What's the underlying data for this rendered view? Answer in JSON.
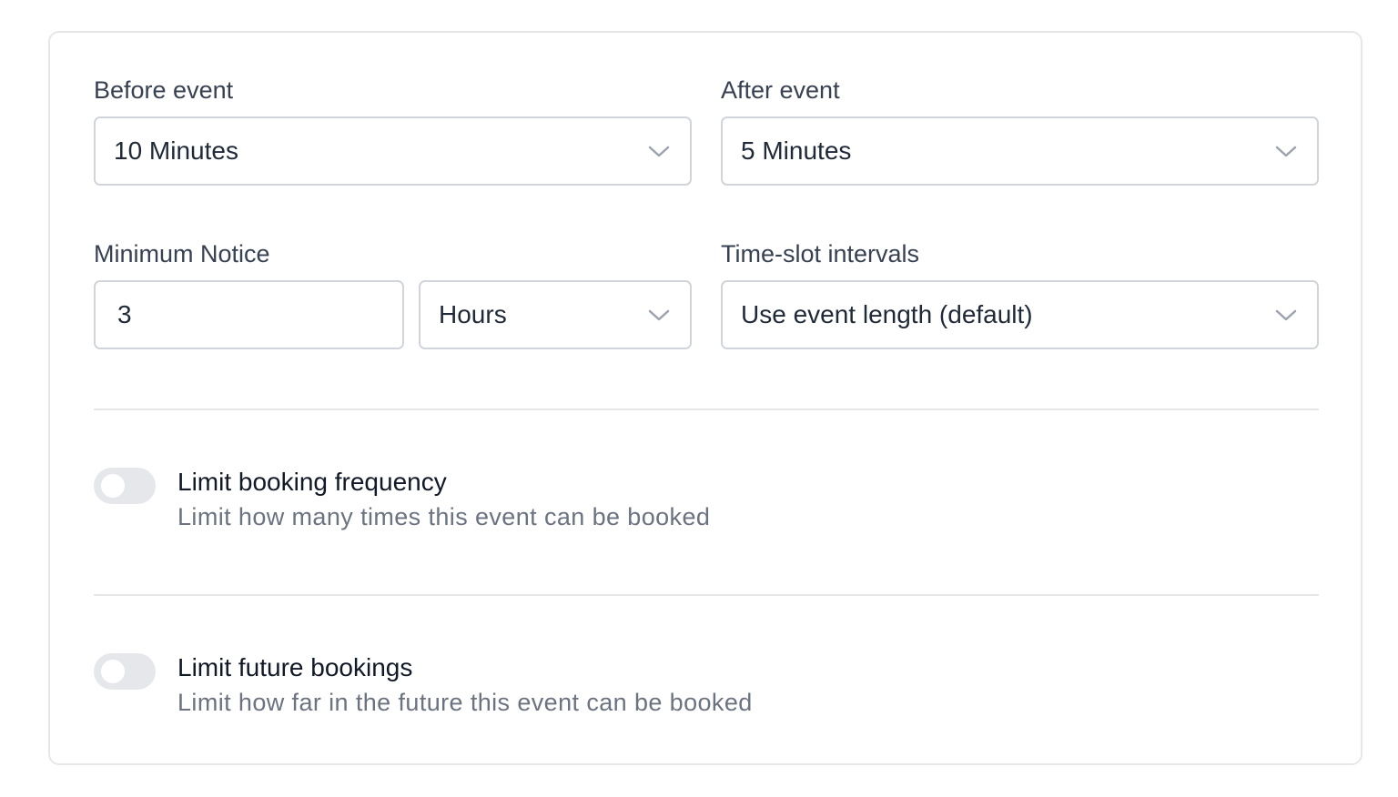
{
  "before_event": {
    "label": "Before event",
    "value": "10 Minutes"
  },
  "after_event": {
    "label": "After event",
    "value": "5 Minutes"
  },
  "minimum_notice": {
    "label": "Minimum Notice",
    "amount": "3",
    "unit": "Hours"
  },
  "time_slot_intervals": {
    "label": "Time-slot intervals",
    "value": "Use event length (default)"
  },
  "limit_booking_frequency": {
    "title": "Limit booking frequency",
    "description": "Limit how many times this event can be booked",
    "enabled": false
  },
  "limit_future_bookings": {
    "title": "Limit future bookings",
    "description": "Limit how far in the future this event can be booked",
    "enabled": false
  },
  "colors": {
    "border": "#d1d5db",
    "divider": "#e5e7eb",
    "toggle_off": "#e5e7eb",
    "chevron": "#9ca3af"
  },
  "icons": {
    "select_arrow": "chevron-down-icon"
  }
}
